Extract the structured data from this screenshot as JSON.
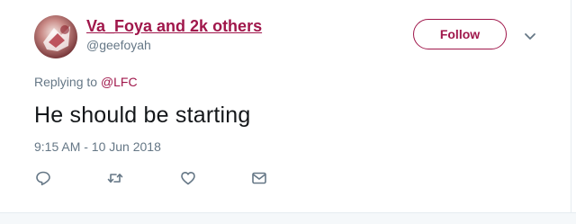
{
  "tweet": {
    "author": {
      "display_name": "Va_Foya and 2k others",
      "handle": "@geefoyah"
    },
    "follow_label": "Follow",
    "reply_context": {
      "prefix": "Replying to ",
      "mention": "@LFC"
    },
    "text": "He should be starting",
    "timestamp": "9:15 AM - 10 Jun 2018"
  },
  "icons": {
    "caret": "chevron-down-icon",
    "reply": "reply-icon",
    "retweet": "retweet-icon",
    "like": "heart-icon",
    "dm": "envelope-icon"
  },
  "colors": {
    "accent": "#a0174b",
    "secondary_text": "#657786",
    "primary_text": "#14171a",
    "border": "#e6ecf0"
  }
}
